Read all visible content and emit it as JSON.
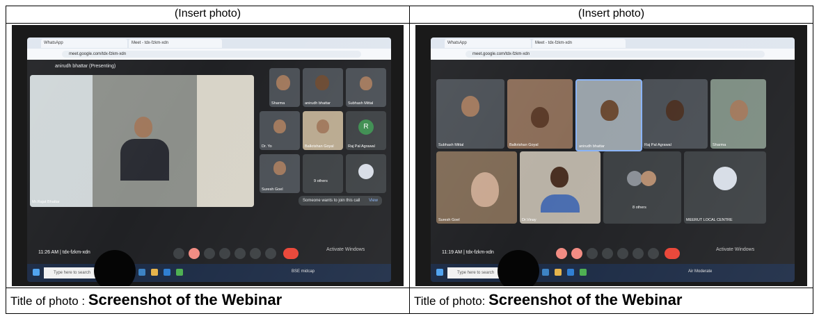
{
  "left": {
    "header": "(Insert photo)",
    "title_prefix": "Title of photo : ",
    "title_bold": "Screenshot of the Webinar",
    "photo": {
      "tabs": [
        "WhatsApp",
        "Meet - tdx-fzkm-xdn"
      ],
      "url": "meet.google.com/tdx-fzkm-xdn",
      "presenter": "anirudh bhattar (Presenting)",
      "main_label": "Mr.Rajat Bhattar",
      "participants": [
        "Sharma",
        "anirudh bhattar",
        "Subhash Mittal",
        "Dr. Yo",
        "Balkrishan Goyal",
        "Raj Pal Agrawal",
        "Suresh Goel",
        "9 others"
      ],
      "avatar_letter": "R",
      "time_code": "11:26 AM | tdx-fzkm-xdn",
      "notification": "Someone wants to join this call",
      "notification_action": "View",
      "activate": "Activate Windows",
      "search_placeholder": "Type here to search",
      "tray": "BSE midcap"
    }
  },
  "right": {
    "header": "(Insert photo)",
    "title_prefix": "Title of photo: ",
    "title_bold": "Screenshot of the Webinar",
    "photo": {
      "tabs": [
        "WhatsApp",
        "Meet - tdx-fzkm-xdn"
      ],
      "url": "meet.google.com/tdx-fzkm-xdn",
      "participants": [
        "Subhash Mittal",
        "Balkrishan Goyal",
        "anirudh bhattar",
        "Raj Pal Agrawal",
        "Sharma",
        "Suresh Goel",
        "Dr.Vinay",
        "8 others",
        "MEERUT LOCAL CENTRE"
      ],
      "time_code": "11:19 AM | tdx-fzkm-xdn",
      "activate": "Activate Windows",
      "search_placeholder": "Type here to search",
      "tray": "Air Moderate"
    }
  },
  "colors": {
    "meet_bg": "#202124",
    "end_call": "#ea4335",
    "taskbar": "#1c2b45"
  }
}
